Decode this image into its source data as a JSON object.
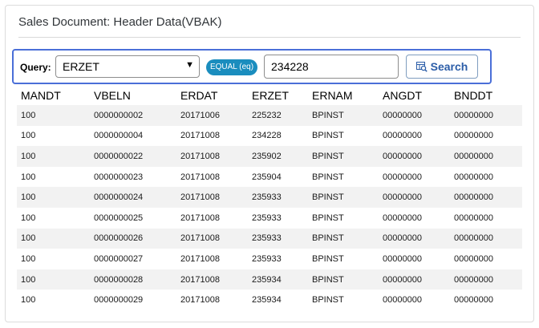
{
  "header": {
    "title": "Sales Document: Header Data(VBAK)"
  },
  "query": {
    "label": "Query:",
    "field": "ERZET",
    "operator": "EQUAL (eq)",
    "value": "234228",
    "search_label": "Search"
  },
  "table": {
    "columns": [
      "MANDT",
      "VBELN",
      "ERDAT",
      "ERZET",
      "ERNAM",
      "ANGDT",
      "BNDDT"
    ],
    "rows": [
      [
        "100",
        "0000000002",
        "20171006",
        "225232",
        "BPINST",
        "00000000",
        "00000000"
      ],
      [
        "100",
        "0000000004",
        "20171008",
        "234228",
        "BPINST",
        "00000000",
        "00000000"
      ],
      [
        "100",
        "0000000022",
        "20171008",
        "235902",
        "BPINST",
        "00000000",
        "00000000"
      ],
      [
        "100",
        "0000000023",
        "20171008",
        "235904",
        "BPINST",
        "00000000",
        "00000000"
      ],
      [
        "100",
        "0000000024",
        "20171008",
        "235933",
        "BPINST",
        "00000000",
        "00000000"
      ],
      [
        "100",
        "0000000025",
        "20171008",
        "235933",
        "BPINST",
        "00000000",
        "00000000"
      ],
      [
        "100",
        "0000000026",
        "20171008",
        "235933",
        "BPINST",
        "00000000",
        "00000000"
      ],
      [
        "100",
        "0000000027",
        "20171008",
        "235933",
        "BPINST",
        "00000000",
        "00000000"
      ],
      [
        "100",
        "0000000028",
        "20171008",
        "235934",
        "BPINST",
        "00000000",
        "00000000"
      ],
      [
        "100",
        "0000000029",
        "20171008",
        "235934",
        "BPINST",
        "00000000",
        "00000000"
      ]
    ]
  },
  "colors": {
    "accent": "#4a6fd8",
    "badge": "#1a8dbe",
    "button_text": "#2b5da8",
    "stripe": "#f2f2f2"
  },
  "icons": {
    "search_button": "table-search-icon",
    "dropdown": "caret-down-icon"
  }
}
